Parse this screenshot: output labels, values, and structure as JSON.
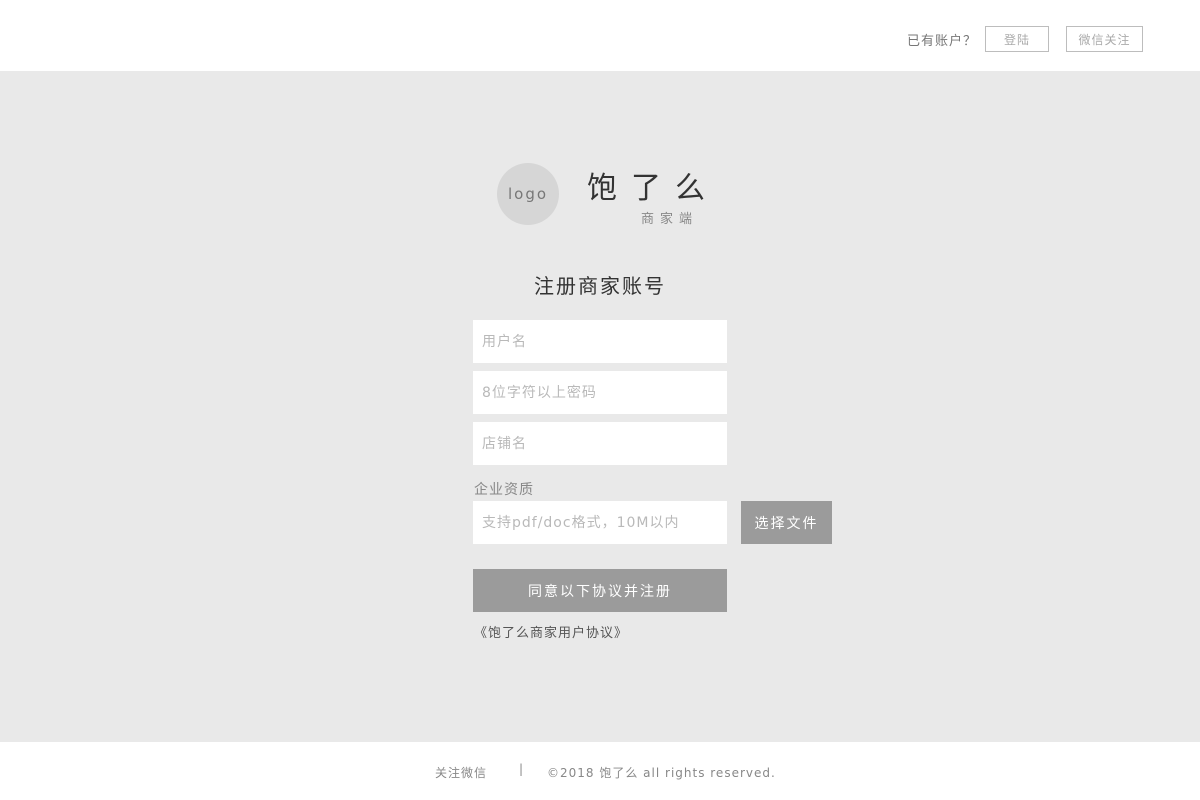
{
  "header": {
    "has_account_text": "已有账户？",
    "login_label": "登陆",
    "wechat_follow_label": "微信关注"
  },
  "brand": {
    "logo_text": "logo",
    "name": "饱了么",
    "subtitle": "商家端"
  },
  "form": {
    "title": "注册商家账号",
    "username_placeholder": "用户名",
    "password_placeholder": "8位字符以上密码",
    "shop_placeholder": "店铺名",
    "qualification_label": "企业资质",
    "file_placeholder": "支持pdf/doc格式，10M以内",
    "choose_file_label": "选择文件",
    "submit_label": "同意以下协议并注册",
    "agreement_link": "《饱了么商家用户协议》"
  },
  "footer": {
    "follow_wechat": "关注微信",
    "separator": "|",
    "copyright": "©2018 饱了么 all rights reserved."
  },
  "colors": {
    "main_bg": "#e9e9e9",
    "button_gray": "#9b9b9b",
    "logo_circle": "#d6d6d6"
  }
}
